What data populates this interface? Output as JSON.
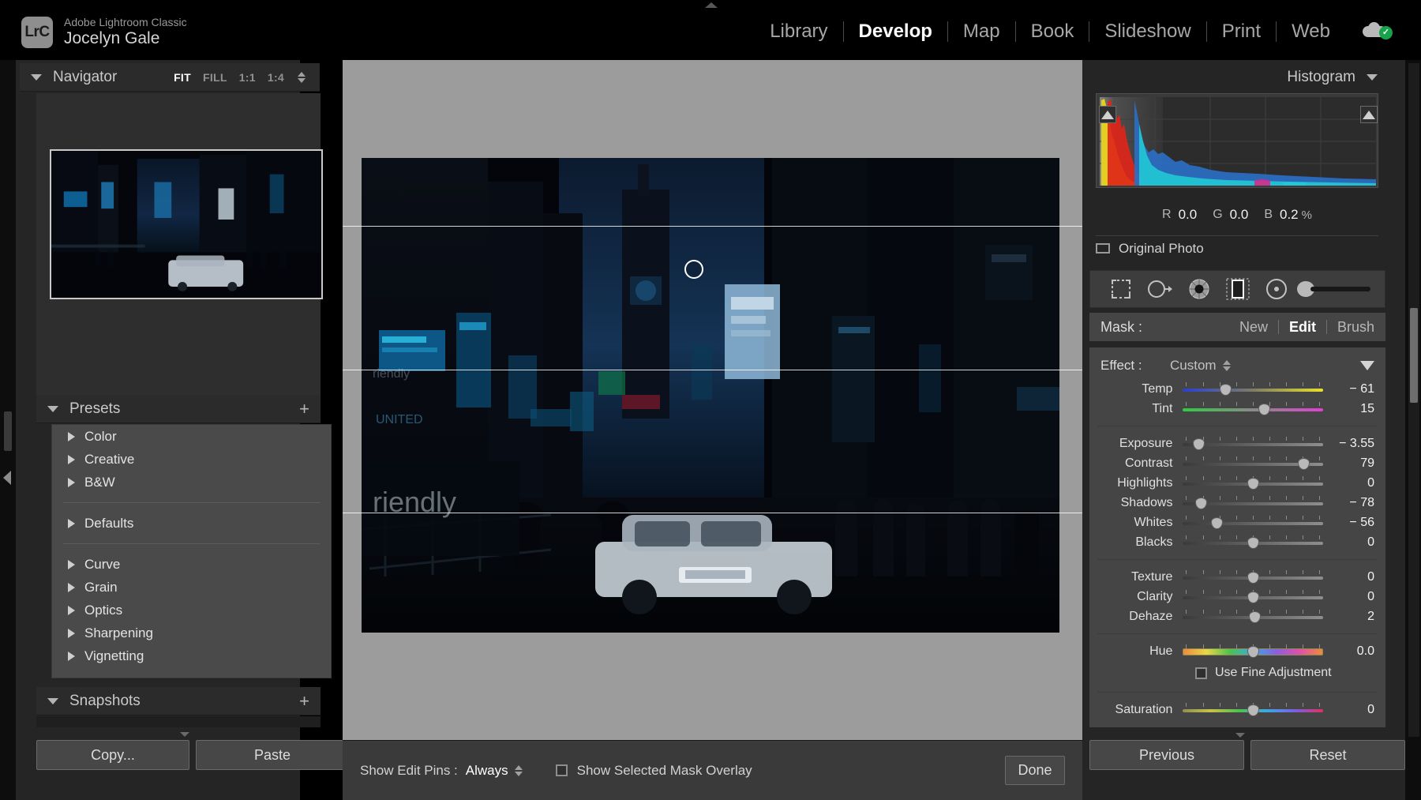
{
  "app": {
    "logo_text": "LrC",
    "product": "Adobe Lightroom Classic",
    "user": "Jocelyn Gale"
  },
  "modules": [
    {
      "label": "Library",
      "active": false
    },
    {
      "label": "Develop",
      "active": true
    },
    {
      "label": "Map",
      "active": false
    },
    {
      "label": "Book",
      "active": false
    },
    {
      "label": "Slideshow",
      "active": false
    },
    {
      "label": "Print",
      "active": false
    },
    {
      "label": "Web",
      "active": false
    }
  ],
  "cloud_status": {
    "icon": "cloud-sync-icon",
    "state": "synced",
    "check": "✓",
    "color": "#16a34a"
  },
  "navigator": {
    "title": "Navigator",
    "zoom_options": [
      {
        "label": "FIT",
        "active": true
      },
      {
        "label": "FILL",
        "active": false
      },
      {
        "label": "1:1",
        "active": false
      },
      {
        "label": "1:4",
        "active": false
      }
    ]
  },
  "presets": {
    "title": "Presets",
    "add_label": "+",
    "groups": [
      [
        "Color",
        "Creative",
        "B&W"
      ],
      [
        "Defaults"
      ],
      [
        "Curve",
        "Grain",
        "Optics",
        "Sharpening",
        "Vignetting"
      ]
    ]
  },
  "snapshots": {
    "title": "Snapshots",
    "add_label": "+"
  },
  "left_buttons": {
    "copy": "Copy...",
    "paste": "Paste"
  },
  "toolbar": {
    "show_edit_pins_label": "Show Edit Pins :",
    "show_edit_pins_value": "Always",
    "mask_overlay_label": "Show Selected Mask Overlay",
    "mask_overlay_checked": false,
    "done_label": "Done"
  },
  "histogram": {
    "title": "Histogram",
    "readout": [
      {
        "channel": "R",
        "value": "0.0"
      },
      {
        "channel": "G",
        "value": "0.0"
      },
      {
        "channel": "B",
        "value": "0.2"
      }
    ],
    "unit": "%",
    "original_photo_label": "Original Photo",
    "original_photo_checked": false,
    "clip_left_icon": "shadow-clipping-icon",
    "clip_right_icon": "highlight-clipping-icon"
  },
  "tools": [
    {
      "name": "crop-tool-icon",
      "selected": false
    },
    {
      "name": "spot-removal-tool-icon",
      "selected": false
    },
    {
      "name": "red-eye-tool-icon",
      "selected": false
    },
    {
      "name": "masking-tool-icon",
      "selected": true
    },
    {
      "name": "radial-gradient-tool-icon",
      "selected": false
    },
    {
      "name": "brush-tool-icon",
      "selected": false
    }
  ],
  "mask_bar": {
    "label": "Mask :",
    "actions": [
      {
        "label": "New",
        "active": false
      },
      {
        "label": "Edit",
        "active": true
      },
      {
        "label": "Brush",
        "active": false
      }
    ]
  },
  "effect": {
    "label": "Effect :",
    "value": "Custom"
  },
  "slider_groups": [
    {
      "sliders": [
        {
          "label": "Temp",
          "value": "− 61",
          "pos": 30,
          "track": "temp"
        },
        {
          "label": "Tint",
          "value": "15",
          "pos": 58,
          "track": "tint"
        }
      ]
    },
    {
      "sliders": [
        {
          "label": "Exposure",
          "value": "− 3.55",
          "pos": 11,
          "track": "dark"
        },
        {
          "label": "Contrast",
          "value": "79",
          "pos": 86,
          "track": "dark"
        },
        {
          "label": "Highlights",
          "value": "0",
          "pos": 50,
          "track": "dark"
        },
        {
          "label": "Shadows",
          "value": "− 78",
          "pos": 13,
          "track": "dark"
        },
        {
          "label": "Whites",
          "value": "− 56",
          "pos": 24,
          "track": "dark"
        },
        {
          "label": "Blacks",
          "value": "0",
          "pos": 50,
          "track": "dark"
        }
      ]
    },
    {
      "sliders": [
        {
          "label": "Texture",
          "value": "0",
          "pos": 50,
          "track": "dark"
        },
        {
          "label": "Clarity",
          "value": "0",
          "pos": 50,
          "track": "dark"
        },
        {
          "label": "Dehaze",
          "value": "2",
          "pos": 51,
          "track": "dark"
        }
      ]
    },
    {
      "sliders": [
        {
          "label": "Hue",
          "value": "0.0",
          "pos": 50,
          "track": "hue"
        }
      ],
      "fine_adjust": {
        "label": "Use Fine Adjustment",
        "checked": false
      }
    },
    {
      "sliders": [
        {
          "label": "Saturation",
          "value": "0",
          "pos": 50,
          "track": "sat"
        }
      ]
    }
  ],
  "right_buttons": {
    "previous": "Previous",
    "reset": "Reset"
  }
}
